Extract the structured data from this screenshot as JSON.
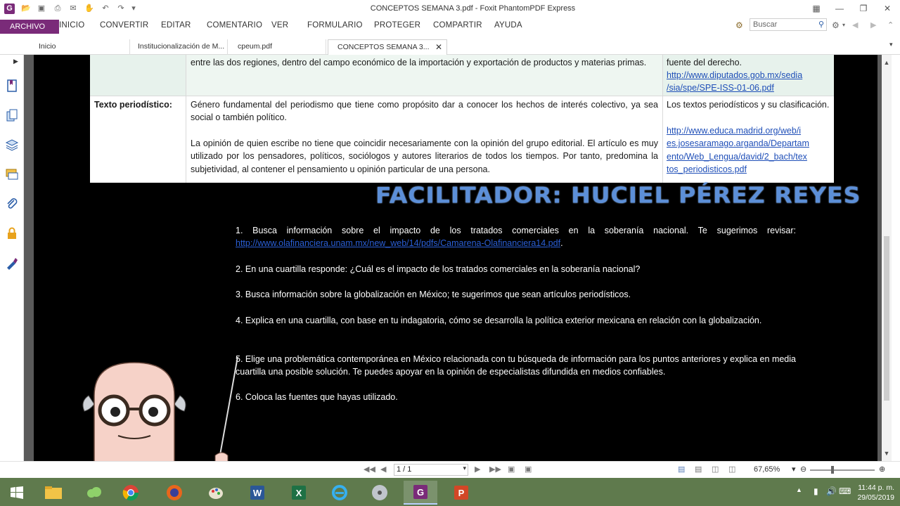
{
  "window": {
    "title": "CONCEPTOS SEMANA 3.pdf - Foxit PhantomPDF Express",
    "app_logo": "G"
  },
  "ribbon": {
    "file": "ARCHIVO",
    "tabs": [
      "INICIO",
      "CONVERTIR",
      "EDITAR",
      "COMENTARIO",
      "VER",
      "FORMULARIO",
      "PROTEGER",
      "COMPARTIR",
      "AYUDA"
    ],
    "search_placeholder": "Buscar"
  },
  "doc_tabs": [
    {
      "label": "Inicio"
    },
    {
      "label": "Institucionalización de M..."
    },
    {
      "label": "cpeum.pdf"
    },
    {
      "label": "CONCEPTOS SEMANA 3...",
      "active": true
    }
  ],
  "document": {
    "row1": {
      "definition": "entre las dos regiones, dentro del campo económico de la importación y exportación de productos y materias primas.",
      "source_text": "fuente del derecho.",
      "source_link": "http://www.diputados.gob.mx/sedia/sia/spe/SPE-ISS-01-06.pdf",
      "source_link_lines": [
        "http://www.diputados.gob.mx/sedia",
        "/sia/spe/SPE-ISS-01-06.pdf"
      ]
    },
    "row2": {
      "term": "Texto periodístico:",
      "definition_p1": "Género fundamental del periodismo que tiene como propósito dar a conocer los hechos de interés colectivo, ya sea social o también político.",
      "definition_p2": "La opinión de quien escribe no tiene que coincidir necesariamente con la opinión del grupo editorial. El artículo es muy utilizado por los pensadores, políticos, sociólogos y autores literarios de todos los tiempos. Por tanto, predomina la subjetividad, al contener el pensamiento u opinión particular de una persona.",
      "source_text": "Los textos periodísticos y su clasificación.",
      "source_link": "http://www.educa.madrid.org/web/ies.josesaramago.arganda/Departamento/Web_Lengua/david/2_bach/textos_periodisticos.pdf",
      "source_link_lines": [
        "http://www.educa.madrid.org/web/i",
        "es.josesaramago.arganda/Departam",
        "ento/Web_Lengua/david/2_bach/tex",
        "tos_periodisticos.pdf"
      ]
    },
    "facilitator": "FACILITADOR: HUCIEL PÉREZ REYES",
    "instructions": {
      "i1_text": "1. Busca información sobre el impacto de los tratados comerciales en la soberanía nacional. Te sugerimos revisar:",
      "i1_link": "http://www.olafinanciera.unam.mx/new_web/14/pdfs/Camarena-Olafinanciera14.pdf",
      "i1_tail": ".",
      "i2": "2. En una cuartilla responde: ¿Cuál es el impacto de los tratados comerciales en la soberanía nacional?",
      "i3": "3. Busca información sobre la globalización en México; te sugerimos que sean artículos periodísticos.",
      "i4": "4. Explica en una cuartilla, con base en tu indagatoria, cómo se desarrolla la política exterior mexicana en relación con la globalización.",
      "i5": "5. Elige una problemática contemporánea en México relacionada con tu búsqueda de información para los puntos anteriores y explica en media cuartilla una posible solución. Te puedes apoyar en la opinión de especialistas difundida en medios confiables.",
      "i6": "6. Coloca las fuentes que hayas utilizado."
    }
  },
  "status": {
    "page": "1 / 1",
    "zoom": "67,65%"
  },
  "taskbar": {
    "time": "11:44 p. m.",
    "date": "29/05/2019"
  },
  "colors": {
    "accent": "#7a2b79",
    "link": "#1f4fb8",
    "facilitator": "#5c8fd8",
    "taskbar": "#5f7a4d"
  }
}
